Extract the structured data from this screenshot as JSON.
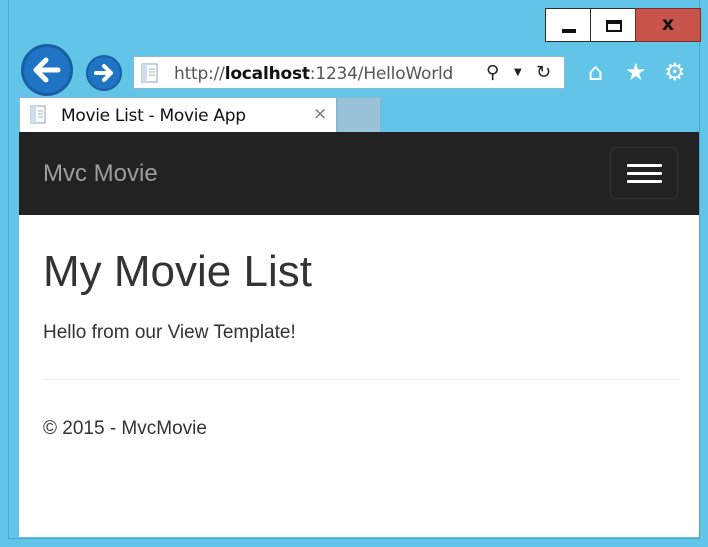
{
  "window": {
    "minimize_glyph": "",
    "close_glyph": "x"
  },
  "address_bar": {
    "url_prefix": "http://",
    "url_host": "localhost",
    "url_path": ":1234/HelloWorld",
    "search_glyph": "⚲",
    "dropdown_glyph": "▼",
    "refresh_glyph": "↻"
  },
  "toolbar": {
    "home_glyph": "⌂",
    "favorites_glyph": "★",
    "settings_glyph": "⚙"
  },
  "tab": {
    "label": "Movie List - Movie App",
    "close_glyph": "×"
  },
  "navbar": {
    "brand": "Mvc Movie",
    "background": "#222222"
  },
  "main": {
    "heading": "My Movie List",
    "message": "Hello from our View Template!"
  },
  "footer": {
    "text": "© 2015 - MvcMovie"
  },
  "colors": {
    "frame": "#62c5e8",
    "nav_button": "#1f74c4",
    "close_button": "#c7534a"
  }
}
